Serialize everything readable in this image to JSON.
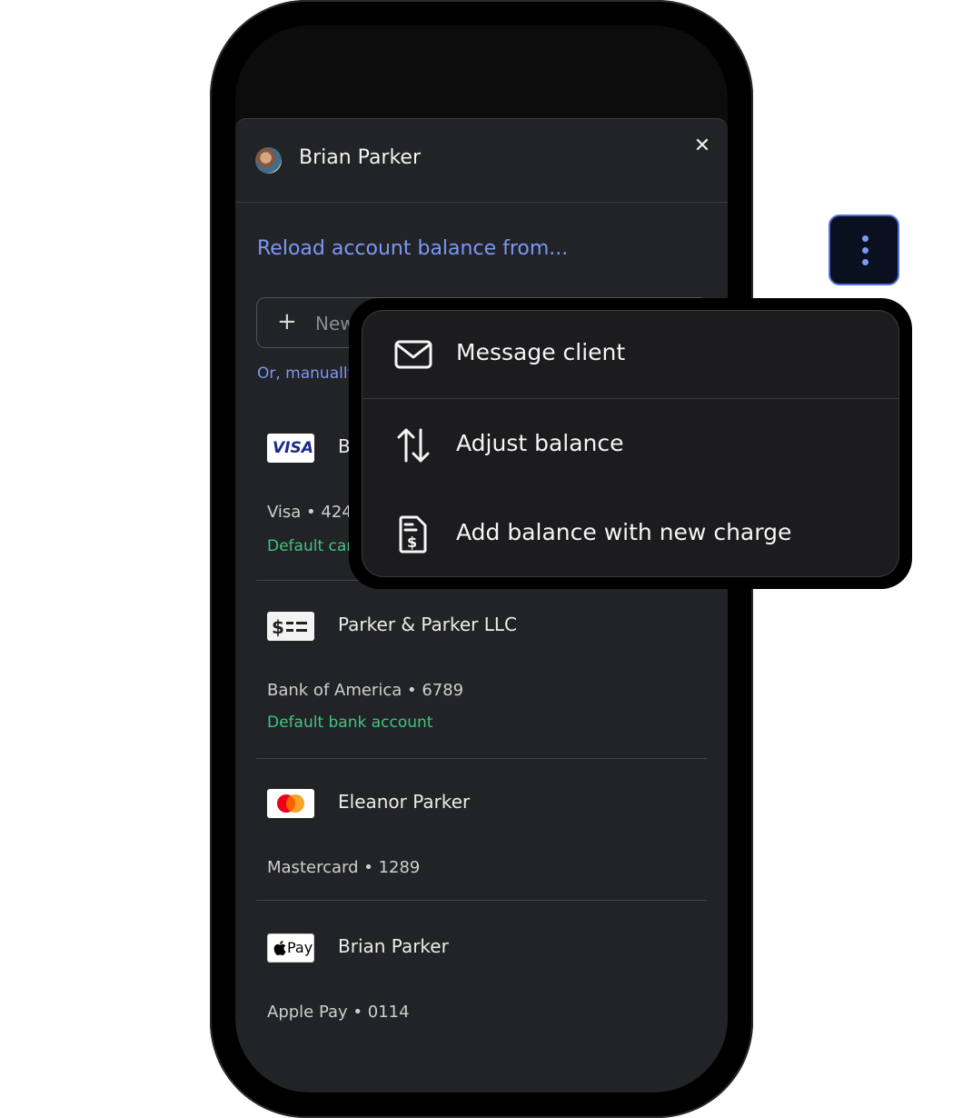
{
  "sheet": {
    "client_name": "Brian Parker",
    "close_glyph": "✕",
    "section_title": "Reload account balance from...",
    "new_button_label": "New",
    "new_button_icon": "+",
    "manual_link": "Or, manually"
  },
  "payment_methods": [
    {
      "logo": "visa-logo",
      "logo_text": "VISA",
      "name": "B",
      "detail": "Visa • 424",
      "default_label": "Default car"
    },
    {
      "logo": "bank-check-icon",
      "name": "Parker & Parker LLC",
      "detail": "Bank of America • 6789",
      "default_label": "Default bank account"
    },
    {
      "logo": "mastercard-logo",
      "name": "Eleanor Parker",
      "detail": "Mastercard • 1289"
    },
    {
      "logo": "apple-pay-logo",
      "logo_text": "Pay",
      "name": "Brian Parker",
      "detail": "Apple Pay • 0114"
    }
  ],
  "menu": {
    "items": [
      {
        "label": "Message client",
        "icon": "envelope-icon"
      },
      {
        "label": "Adjust balance",
        "icon": "up-down-arrows-icon"
      },
      {
        "label": "Add balance with new charge",
        "icon": "invoice-dollar-icon"
      }
    ]
  },
  "colors": {
    "accent": "#7c97f4",
    "success": "#3fc57f",
    "sheet_bg": "#222326",
    "menu_bg": "#1c1c1e"
  }
}
